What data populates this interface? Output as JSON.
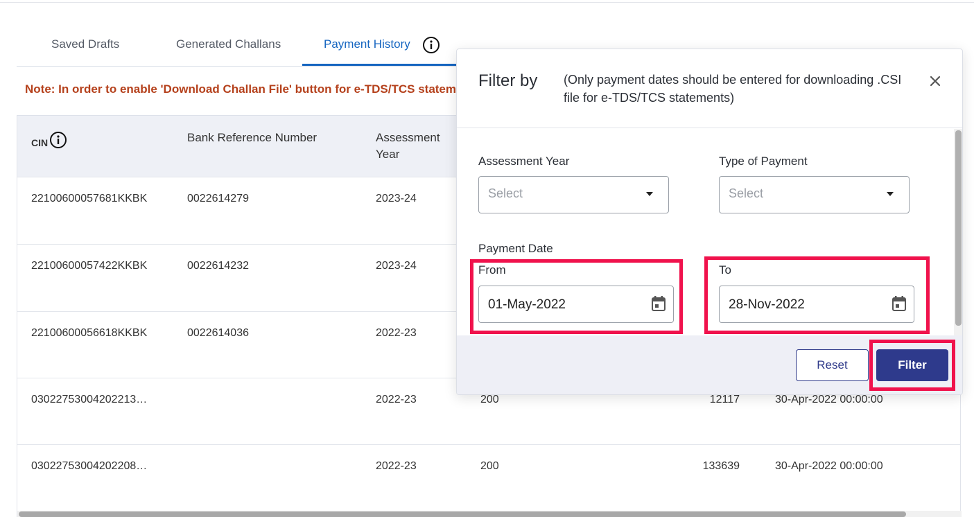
{
  "tabs": [
    {
      "label": "Saved Drafts"
    },
    {
      "label": "Generated Challans"
    },
    {
      "label": "Payment History"
    }
  ],
  "note": "Note: In order to enable 'Download Challan File' button for e-TDS/TCS statem",
  "table": {
    "headers": {
      "cin": "CIN",
      "bank_ref": "Bank Reference Number",
      "assessment_year": "Assessment Year"
    },
    "rows": [
      {
        "cin": "22100600057681KKBK",
        "bank_ref": "0022614279",
        "ay": "2023-24",
        "col4": "",
        "col5": "",
        "date": ""
      },
      {
        "cin": "22100600057422KKBK",
        "bank_ref": "0022614232",
        "ay": "2023-24",
        "col4": "",
        "col5": "",
        "date": ""
      },
      {
        "cin": "22100600056618KKBK",
        "bank_ref": "0022614036",
        "ay": "2022-23",
        "col4": "",
        "col5": "",
        "date": ""
      },
      {
        "cin": "03022753004202213…",
        "bank_ref": "",
        "ay": "2022-23",
        "col4": "200",
        "col5": "12117",
        "date": "30-Apr-2022 00:00:00"
      },
      {
        "cin": "03022753004202208…",
        "bank_ref": "",
        "ay": "2022-23",
        "col4": "200",
        "col5": "133639",
        "date": "30-Apr-2022 00:00:00"
      }
    ]
  },
  "modal": {
    "title": "Filter by",
    "subtitle": "(Only payment dates should be entered for downloading .CSI file for e-TDS/TCS statements)",
    "assessment_year_label": "Assessment Year",
    "assessment_year_placeholder": "Select",
    "type_of_payment_label": "Type of Payment",
    "type_of_payment_placeholder": "Select",
    "payment_date_label": "Payment Date",
    "from_label": "From",
    "from_value": "01-May-2022",
    "to_label": "To",
    "to_value": "28-Nov-2022",
    "reset_label": "Reset",
    "filter_label": "Filter"
  },
  "colors": {
    "accent": "#1565c0",
    "note": "#b5411c",
    "highlight": "#f0124c",
    "primary_button": "#2e3a8c"
  }
}
